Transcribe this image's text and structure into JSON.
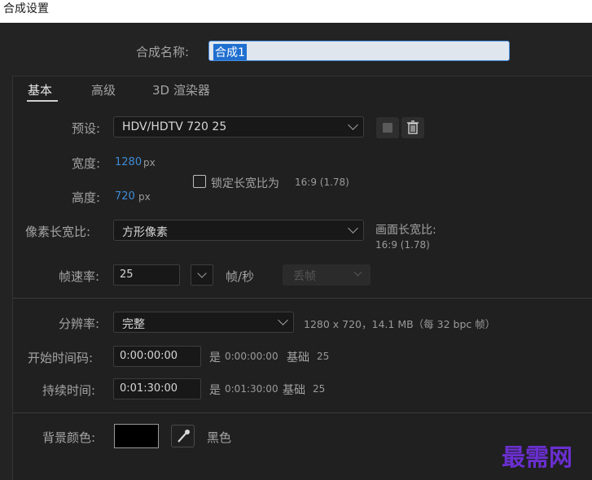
{
  "window": {
    "title": "合成设置"
  },
  "comp_name": {
    "label": "合成名称:",
    "value": "合成1"
  },
  "tabs": [
    {
      "label": "基本",
      "active": true
    },
    {
      "label": "高级",
      "active": false
    },
    {
      "label": "3D 渲染器",
      "active": false
    }
  ],
  "preset": {
    "label": "预设:",
    "value": "HDV/HDTV 720 25"
  },
  "width": {
    "label": "宽度:",
    "value": "1280",
    "unit": "px"
  },
  "height": {
    "label": "高度:",
    "value": "720",
    "unit": "px"
  },
  "lock_ratio": {
    "label": "锁定长宽比为",
    "value": "16:9 (1.78)",
    "checked": false
  },
  "pixel_aspect": {
    "label": "像素长宽比:",
    "value": "方形像素"
  },
  "frame_aspect": {
    "label": "画面长宽比:",
    "value": "16:9 (1.78)"
  },
  "frame_rate": {
    "label": "帧速率:",
    "value": "25",
    "unit": "帧/秒",
    "drop_frame": "丢帧"
  },
  "resolution": {
    "label": "分辨率:",
    "value": "完整",
    "info": "1280 x 720，14.1 MB（每 32 bpc 帧）"
  },
  "start_timecode": {
    "label": "开始时间码:",
    "value": "0:00:00:00",
    "is": "是",
    "is_value": "0:00:00:00",
    "base": "基础",
    "base_value": "25"
  },
  "duration": {
    "label": "持续时间:",
    "value": "0:01:30:00",
    "is": "是",
    "is_value": "0:01:30:00",
    "base": "基础",
    "base_value": "25"
  },
  "background": {
    "label": "背景颜色:",
    "color_name": "黑色",
    "color": "#000000"
  },
  "watermark": {
    "text": "最需网"
  },
  "colors": {
    "accent": "#3f8bd6",
    "selection": "#1f6fd0",
    "watermark": "#6a2fd0"
  }
}
